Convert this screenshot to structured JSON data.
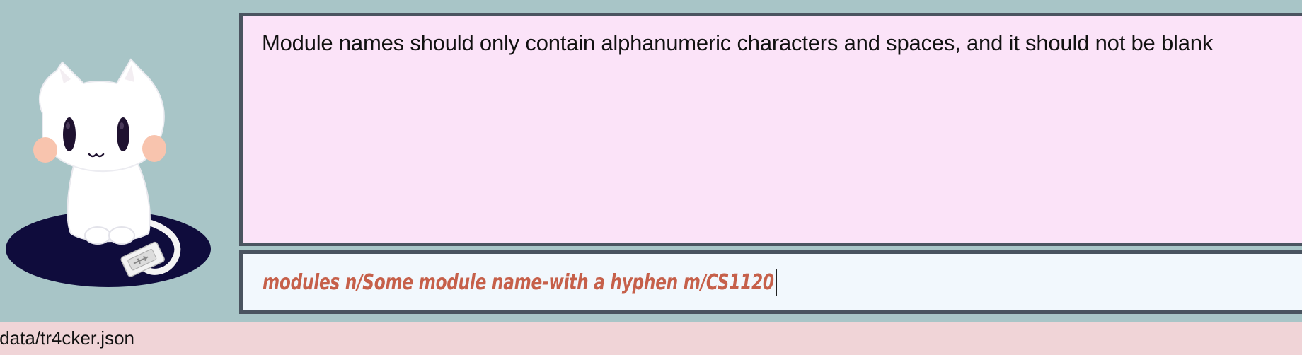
{
  "result": {
    "message": "Module names should only contain alphanumeric characters and spaces, and it should not be blank"
  },
  "command": {
    "value": "modules n/Some module name-with a hyphen m/CS1120"
  },
  "status_bar": {
    "file_path": "/data/tr4cker.json"
  },
  "mascot": {
    "icon": "cat-with-usb-mascot-icon"
  },
  "colors": {
    "background": "#a8c5c7",
    "result_bg": "#fbe3f8",
    "command_bg": "#f2f8fd",
    "border": "#4a5460",
    "command_text": "#c6604a",
    "status_bg": "#f0d4d7"
  }
}
